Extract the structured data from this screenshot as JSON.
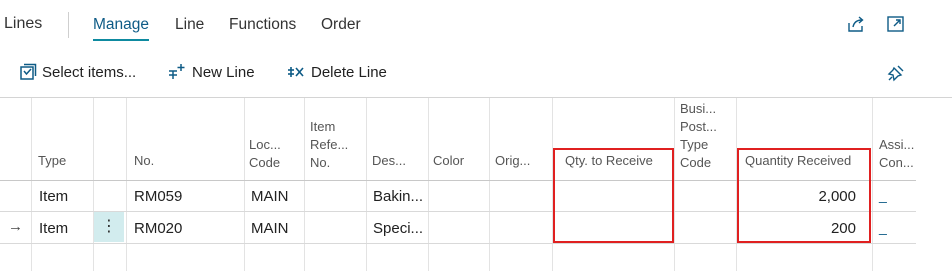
{
  "header": {
    "title": "Lines",
    "tabs": [
      {
        "label": "Manage",
        "active": true
      },
      {
        "label": "Line"
      },
      {
        "label": "Functions"
      },
      {
        "label": "Order"
      }
    ],
    "icons": [
      "share-icon",
      "expand-icon"
    ]
  },
  "actions": [
    {
      "label": "Select items...",
      "icon": "select-items-icon"
    },
    {
      "label": "New Line",
      "icon": "new-line-icon"
    },
    {
      "label": "Delete Line",
      "icon": "delete-line-icon"
    }
  ],
  "pin_icon": "pin-icon",
  "columns": {
    "type": [
      "Type"
    ],
    "no": [
      "No."
    ],
    "loc_code": [
      "Loc...",
      "Code"
    ],
    "item_ref_no": [
      "Item",
      "Refe...",
      "No."
    ],
    "description": [
      "Des..."
    ],
    "color": [
      "Color"
    ],
    "orig": [
      "Orig..."
    ],
    "qty_to_receive": [
      "Qty. to Receive"
    ],
    "bus_post_type": [
      "Busi...",
      "Post...",
      "Type",
      "Code"
    ],
    "quantity_received": [
      "Quantity Received"
    ],
    "assi_con": [
      "Assi...",
      "Con..."
    ]
  },
  "rows": [
    {
      "marker": "",
      "type": "Item",
      "no": "RM059",
      "loc": "MAIN",
      "desc": "Bakin...",
      "qty_to_receive": "",
      "quantity_received": "2,000",
      "assi": "_"
    },
    {
      "marker": "→",
      "type": "Item",
      "no": "RM020",
      "loc": "MAIN",
      "desc": "Speci...",
      "qty_to_receive": "",
      "quantity_received": "200",
      "assi": "_",
      "selected": true
    }
  ],
  "row_menu_glyph": "⋮",
  "colors": {
    "accent": "#0e5b86",
    "highlight_box": "#e02020",
    "row_menu_bg": "#d2ecee"
  }
}
